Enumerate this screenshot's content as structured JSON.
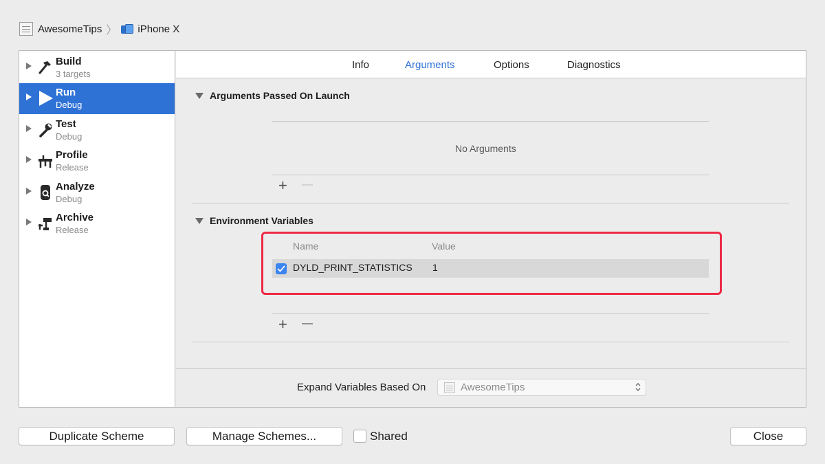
{
  "breadcrumb": {
    "project": "AwesomeTips",
    "separator": "〉",
    "device": "iPhone X",
    "project_icon": "project-file-icon",
    "device_icon": "iphone-simulator-icon"
  },
  "sidebar": {
    "items": [
      {
        "name": "Build",
        "sub": "3 targets",
        "icon": "hammer-icon"
      },
      {
        "name": "Run",
        "sub": "Debug",
        "icon": "play-icon",
        "selected": true
      },
      {
        "name": "Test",
        "sub": "Debug",
        "icon": "wrench-icon"
      },
      {
        "name": "Profile",
        "sub": "Release",
        "icon": "instruments-icon"
      },
      {
        "name": "Analyze",
        "sub": "Debug",
        "icon": "analyze-icon"
      },
      {
        "name": "Archive",
        "sub": "Release",
        "icon": "archive-icon"
      }
    ]
  },
  "tabs": {
    "items": [
      "Info",
      "Arguments",
      "Options",
      "Diagnostics"
    ],
    "active": "Arguments"
  },
  "arguments": {
    "title": "Arguments Passed On Launch",
    "empty": "No Arguments",
    "add": "+",
    "remove": "—"
  },
  "environment": {
    "title": "Environment Variables",
    "col_name": "Name",
    "col_value": "Value",
    "rows": [
      {
        "checked": true,
        "name": "DYLD_PRINT_STATISTICS",
        "value": "1"
      }
    ],
    "add": "+",
    "remove": "—"
  },
  "expand": {
    "label": "Expand Variables Based On",
    "value": "AwesomeTips"
  },
  "buttons": {
    "duplicate": "Duplicate Scheme",
    "manage": "Manage Schemes...",
    "shared": "Shared",
    "shared_checked": false,
    "close": "Close"
  },
  "colors": {
    "accent": "#2f72d6",
    "highlight_box": "#ee2945",
    "checkbox": "#3a84f0"
  }
}
